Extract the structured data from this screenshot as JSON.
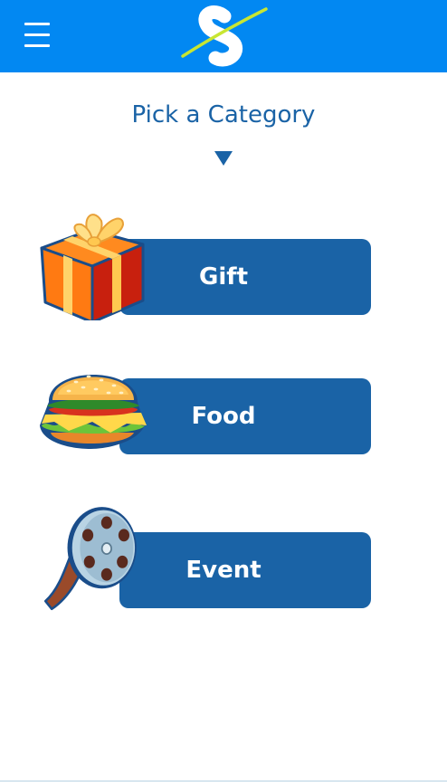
{
  "header": {
    "menu_icon": "hamburger-menu-icon",
    "logo_icon": "s-swoosh-logo-icon",
    "background_color": "#0288f2"
  },
  "main": {
    "title": "Pick a Category",
    "title_arrow_icon": "triangle-down-icon",
    "accent_color": "#1a63a6"
  },
  "categories": [
    {
      "label": "Gift",
      "icon": "gift-box-icon"
    },
    {
      "label": "Food",
      "icon": "hamburger-food-icon"
    },
    {
      "label": "Event",
      "icon": "film-reel-icon"
    }
  ]
}
